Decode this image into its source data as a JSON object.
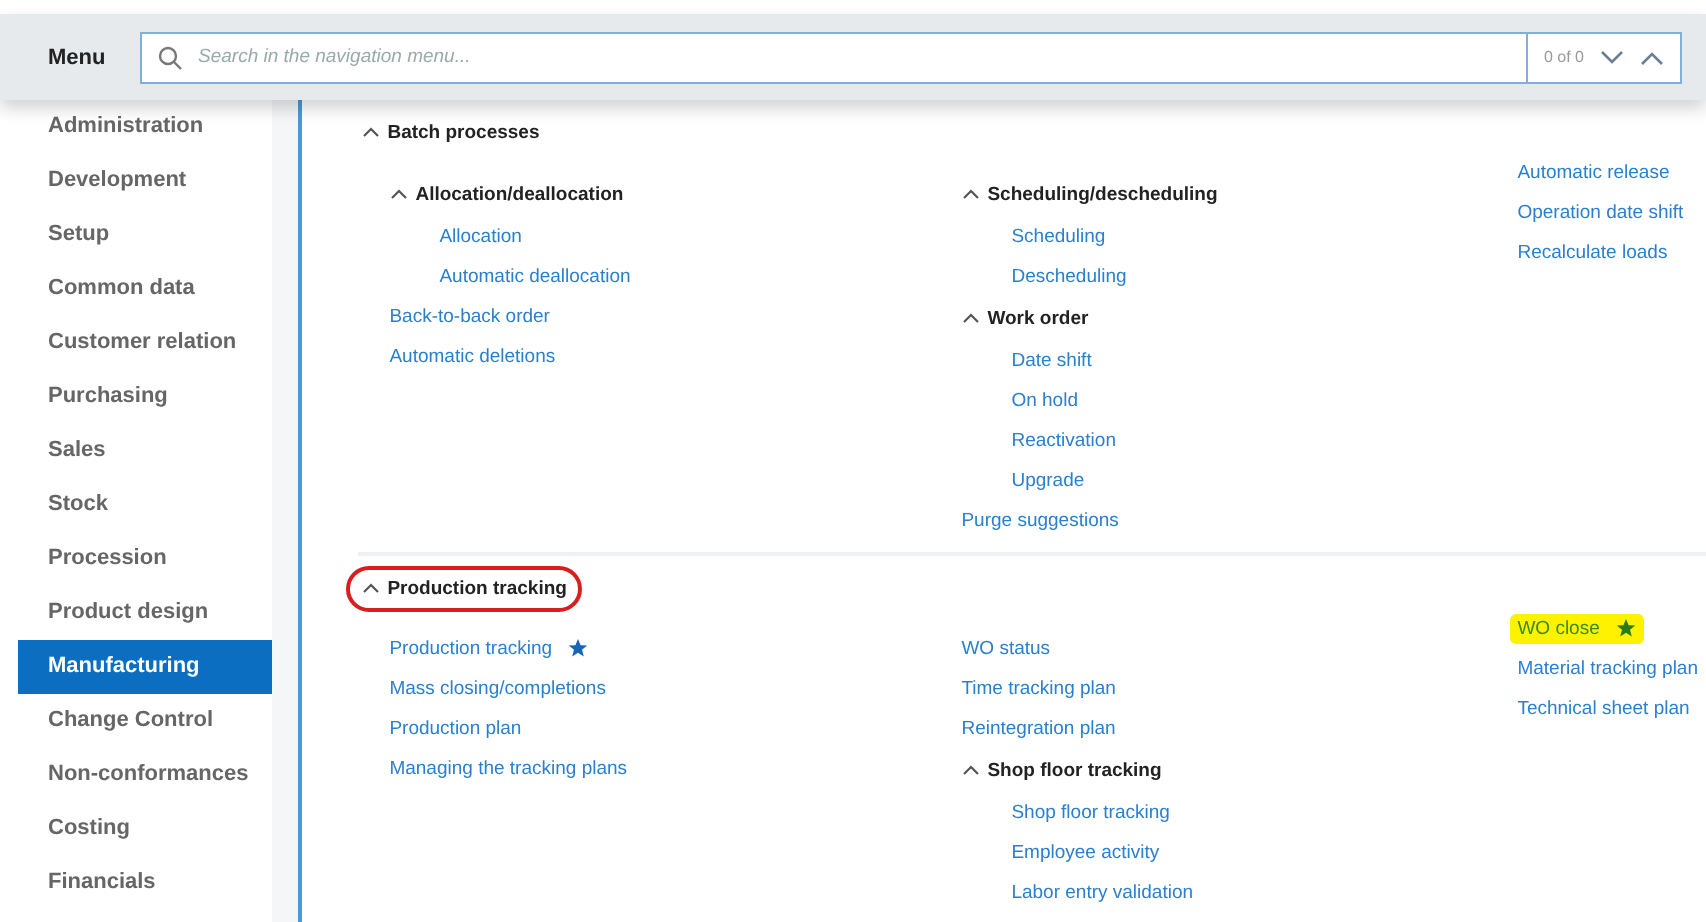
{
  "header": {
    "title": "Menu",
    "search": {
      "placeholder": "Search in the navigation menu...",
      "count": "0 of 0"
    }
  },
  "sidebar": {
    "items": [
      {
        "label": "Administration",
        "selected": false
      },
      {
        "label": "Development",
        "selected": false
      },
      {
        "label": "Setup",
        "selected": false
      },
      {
        "label": "Common data",
        "selected": false
      },
      {
        "label": "Customer relation",
        "selected": false
      },
      {
        "label": "Purchasing",
        "selected": false
      },
      {
        "label": "Sales",
        "selected": false
      },
      {
        "label": "Stock",
        "selected": false
      },
      {
        "label": "Procession",
        "selected": false
      },
      {
        "label": "Product design",
        "selected": false
      },
      {
        "label": "Manufacturing",
        "selected": true
      },
      {
        "label": "Change Control",
        "selected": false
      },
      {
        "label": "Non-conformances",
        "selected": false
      },
      {
        "label": "Costing",
        "selected": false
      },
      {
        "label": "Financials",
        "selected": false
      }
    ]
  },
  "sections": [
    {
      "title": "Batch processes",
      "expanded": true,
      "circled": false,
      "columns": [
        [
          {
            "kind": "group",
            "title": "Allocation/deallocation",
            "expanded": true,
            "children": [
              {
                "kind": "link",
                "label": "Allocation"
              },
              {
                "kind": "link",
                "label": "Automatic deallocation"
              }
            ]
          },
          {
            "kind": "link",
            "label": "Back-to-back order"
          },
          {
            "kind": "link",
            "label": "Automatic deletions"
          }
        ],
        [
          {
            "kind": "group",
            "title": "Scheduling/descheduling",
            "expanded": true,
            "children": [
              {
                "kind": "link",
                "label": "Scheduling"
              },
              {
                "kind": "link",
                "label": "Descheduling"
              }
            ]
          },
          {
            "kind": "group",
            "title": "Work order",
            "expanded": true,
            "children": [
              {
                "kind": "link",
                "label": "Date shift"
              },
              {
                "kind": "link",
                "label": "On hold"
              },
              {
                "kind": "link",
                "label": "Reactivation"
              },
              {
                "kind": "link",
                "label": "Upgrade"
              }
            ]
          },
          {
            "kind": "link",
            "label": "Purge suggestions"
          }
        ],
        [
          {
            "kind": "link",
            "label": "Automatic release"
          },
          {
            "kind": "link",
            "label": "Operation date shift"
          },
          {
            "kind": "link",
            "label": "Recalculate loads"
          }
        ]
      ]
    },
    {
      "title": "Production tracking",
      "expanded": true,
      "circled": true,
      "columns": [
        [
          {
            "kind": "link",
            "label": "Production tracking",
            "favorite": true
          },
          {
            "kind": "link",
            "label": "Mass closing/completions"
          },
          {
            "kind": "link",
            "label": "Production plan"
          },
          {
            "kind": "link",
            "label": "Managing the tracking plans"
          }
        ],
        [
          {
            "kind": "link",
            "label": "WO status"
          },
          {
            "kind": "link",
            "label": "Time tracking plan"
          },
          {
            "kind": "link",
            "label": "Reintegration plan"
          },
          {
            "kind": "group",
            "title": "Shop floor tracking",
            "expanded": true,
            "children": [
              {
                "kind": "link",
                "label": "Shop floor tracking"
              },
              {
                "kind": "link",
                "label": "Employee activity"
              },
              {
                "kind": "link",
                "label": "Labor entry validation"
              }
            ]
          }
        ],
        [
          {
            "kind": "link",
            "label": "WO close",
            "favorite": true,
            "highlighted": true
          },
          {
            "kind": "link",
            "label": "Material tracking plan"
          },
          {
            "kind": "link",
            "label": "Technical sheet plan"
          }
        ]
      ]
    }
  ]
}
